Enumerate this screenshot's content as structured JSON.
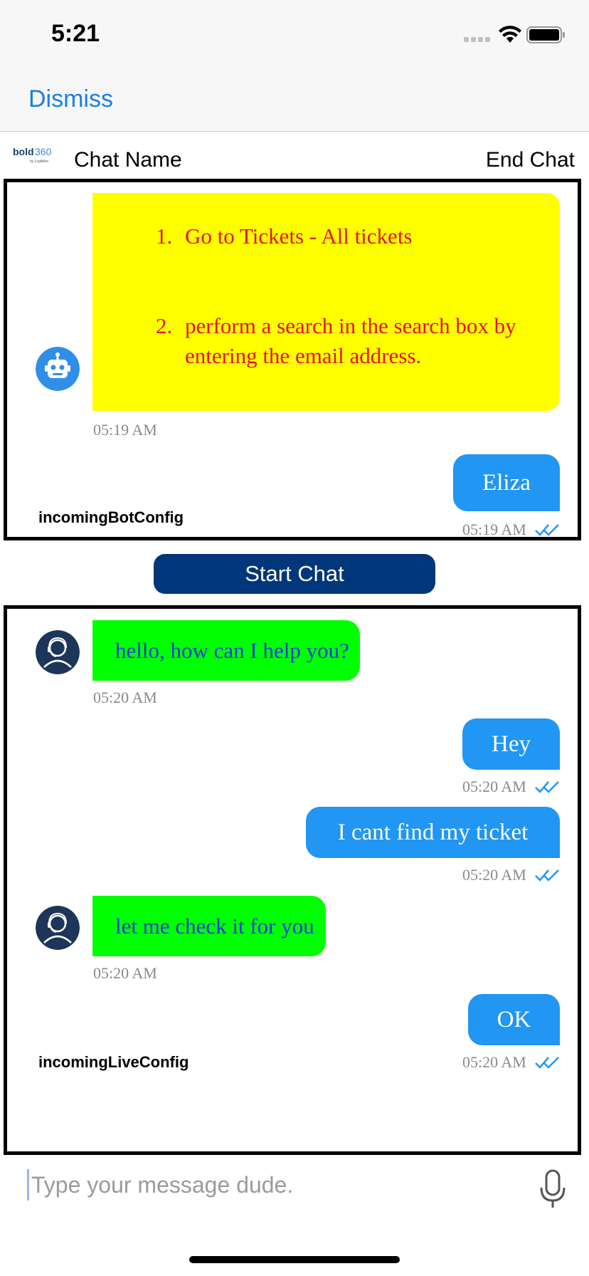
{
  "status_bar": {
    "time": "5:21"
  },
  "nav": {
    "dismiss_label": "Dismiss"
  },
  "header": {
    "logo_alt": "bold360 by LogMeIn",
    "chat_name": "Chat Name",
    "end_chat_label": "End Chat"
  },
  "bot_panel": {
    "config_label": "incomingBotConfig",
    "bot_message": {
      "items": [
        "Go to Tickets - All tickets",
        "perform a search in the search box by entering the email address."
      ],
      "time": "05:19 AM"
    },
    "user_message": {
      "text": "Eliza",
      "time": "05:19 AM"
    }
  },
  "start_chat_label": "Start Chat",
  "live_panel": {
    "config_label": "incomingLiveConfig",
    "messages": [
      {
        "from": "agent",
        "text": "hello, how can I help you?",
        "time": "05:20 AM"
      },
      {
        "from": "user",
        "text": "Hey",
        "time": "05:20 AM"
      },
      {
        "from": "user",
        "text": "I cant find my ticket",
        "time": "05:20 AM"
      },
      {
        "from": "agent",
        "text": "let me check it for you",
        "time": "05:20 AM"
      },
      {
        "from": "user",
        "text": "OK",
        "time": "05:20 AM"
      }
    ]
  },
  "composer": {
    "placeholder": "Type your message dude.",
    "value": ""
  },
  "colors": {
    "link_blue": "#1a7fe6",
    "bot_bubble": "#ffff00",
    "bot_text": "#e6121b",
    "user_bubble": "#2196f3",
    "agent_bubble": "#00ff00",
    "agent_text": "#1b3bd4",
    "start_chat_bg": "#00367a",
    "read_ticks": "#2196f3"
  },
  "icons": [
    "signal-icon",
    "wifi-icon",
    "battery-icon",
    "bold360-logo",
    "bot-avatar-icon",
    "agent-avatar-icon",
    "read-receipt-icon",
    "microphone-icon"
  ]
}
